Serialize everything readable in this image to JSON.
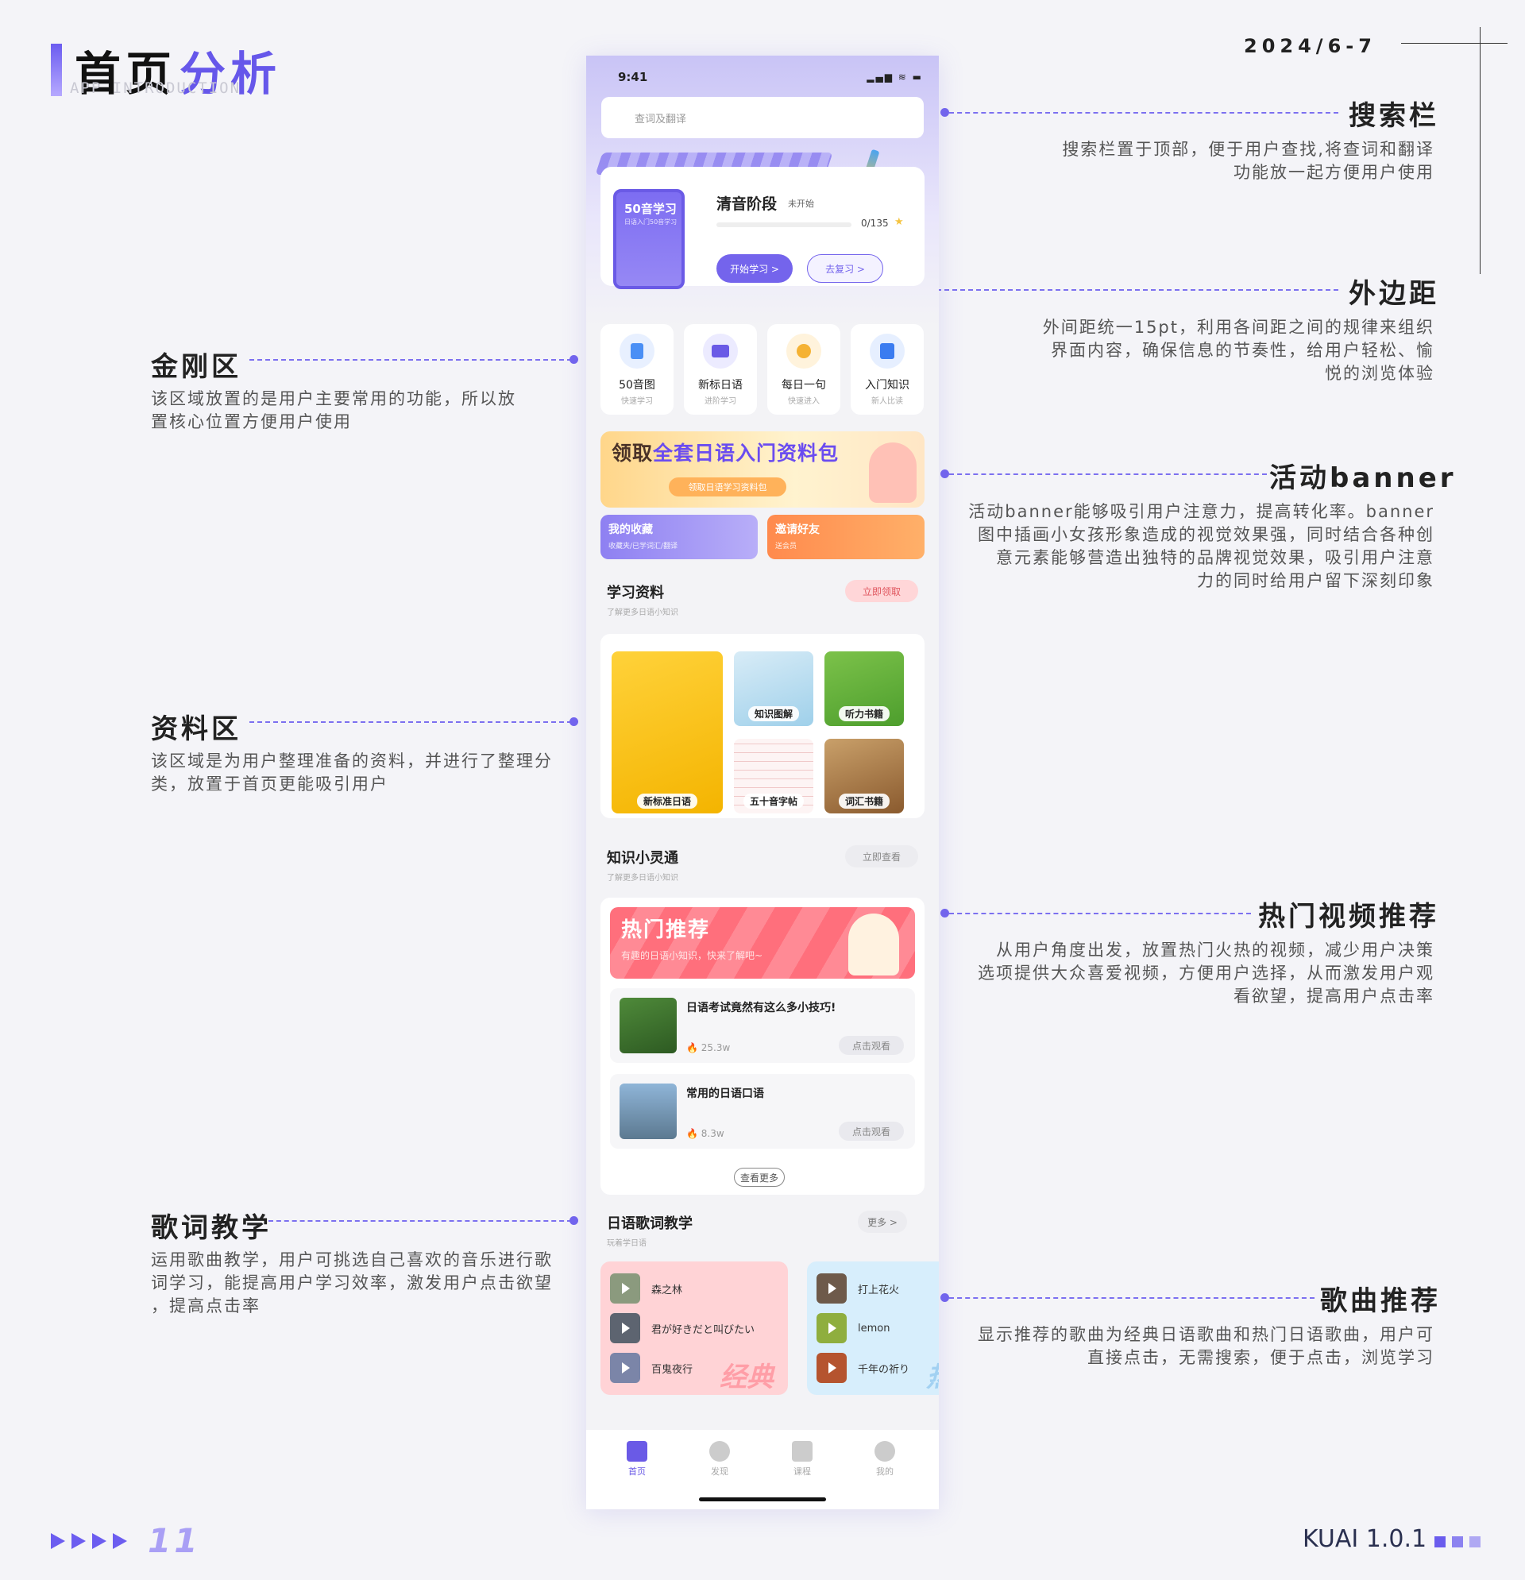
{
  "header": {
    "title_a": "首页",
    "title_b": "分析",
    "subtitle": "APP INTRODUCTION",
    "date": "2024/6-7"
  },
  "annotations": {
    "search": {
      "title": "搜索栏",
      "lines": [
        "搜索栏置于顶部，便于用户查找,将查词和翻译",
        "功能放一起方便用户使用"
      ]
    },
    "margin": {
      "title": "外边距",
      "lines": [
        "外间距统一15pt，利用各间距之间的规律来组织",
        "界面内容，确保信息的节奏性，给用户轻松、愉",
        "悦的浏览体验"
      ]
    },
    "banner": {
      "title": "活动banner",
      "lines": [
        "活动banner能够吸引用户注意力，提高转化率。banner",
        "图中插画小女孩形象造成的视觉效果强，同时结合各种创",
        "意元素能够营造出独特的品牌视觉效果，吸引用户注意",
        "力的同时给用户留下深刻印象"
      ]
    },
    "kingkong": {
      "title": "金刚区",
      "lines": [
        "该区域放置的是用户主要常用的功能，所以放",
        "置核心位置方便用户使用"
      ]
    },
    "resource": {
      "title": "资料区",
      "lines": [
        "该区域是为用户整理准备的资料，并进行了整理分",
        "类，放置于首页更能吸引用户"
      ]
    },
    "hot": {
      "title": "热门视频推荐",
      "lines": [
        "从用户角度出发，放置热门火热的视频，减少用户决策",
        "选项提供大众喜爱视频，方便用户选择，从而激发用户观",
        "看欲望，提高用户点击率"
      ]
    },
    "lyric": {
      "title": "歌词教学",
      "lines": [
        "运用歌曲教学，用户可挑选自己喜欢的音乐进行歌",
        "词学习，能提高用户学习效率，激发用户点击欲望",
        "，提高点击率"
      ]
    },
    "song": {
      "title": "歌曲推荐",
      "lines": [
        "显示推荐的歌曲为经典日语歌曲和热门日语歌曲，用户可",
        "直接点击，无需搜索，便于点击，浏览学习"
      ]
    }
  },
  "footer": {
    "page_number": "11",
    "version": "KUAI 1.0.1"
  },
  "phone": {
    "status": {
      "time": "9:41"
    },
    "search_placeholder": "查词及翻译",
    "course": {
      "book_title": "50音学习",
      "book_sub": "日语入门50音学习",
      "stage": "清音阶段",
      "stage_status": "未开始",
      "progress_text": "0/135",
      "progress": 0,
      "start": "开始学习 >",
      "review": "去复习 >"
    },
    "kingkong": [
      {
        "title": "50音图",
        "sub": "快速学习",
        "icon": "document-icon",
        "color": "#4a8ff5"
      },
      {
        "title": "新标日语",
        "sub": "进阶学习",
        "icon": "folder-icon",
        "color": "#6a5ae6"
      },
      {
        "title": "每日一句",
        "sub": "快速进入",
        "icon": "lightbulb-icon",
        "color": "#f5b233"
      },
      {
        "title": "入门知识",
        "sub": "新人比读",
        "icon": "book-icon",
        "color": "#3b7cf0"
      }
    ],
    "banner": {
      "heading_a": "领取",
      "heading_b": "全套日语入门资料包",
      "pill": "领取日语学习资料包"
    },
    "tiles": [
      {
        "title": "我的收藏",
        "sub": "收藏夹/已学词汇/翻译"
      },
      {
        "title": "邀请好友",
        "sub": "送会员"
      }
    ],
    "study": {
      "title": "学习资料",
      "sub": "了解更多日语小知识",
      "btn": "立即领取",
      "items": [
        "新标准日语",
        "知识图解",
        "听力书籍",
        "五十音字帖",
        "词汇书籍"
      ]
    },
    "knowledge": {
      "title": "知识小灵通",
      "sub": "了解更多日语小知识",
      "btn": "立即查看"
    },
    "hot": {
      "banner_title": "热门推荐",
      "banner_sub": "有趣的日语小知识，快来了解吧~",
      "videos": [
        {
          "title": "日语考试竟然有这么多小技巧!",
          "count": "25.3w",
          "btn": "点击观看"
        },
        {
          "title": "常用的日语口语",
          "count": "8.3w",
          "btn": "点击观看"
        }
      ],
      "more": "查看更多"
    },
    "lyrics": {
      "title": "日语歌词教学",
      "sub": "玩着学日语",
      "more": "更多 >",
      "classic": [
        "森之林",
        "君が好きだと叫びたい",
        "百鬼夜行"
      ],
      "classic_wm": "经典",
      "hot": [
        "打上花火",
        "lemon",
        "千年の祈り"
      ],
      "hot_wm": "热"
    },
    "tabs": [
      "首页",
      "发现",
      "课程",
      "我的"
    ]
  },
  "colors": {
    "accent": "#6657ea",
    "hot": "#ff6f7c",
    "gold": "#f5c440"
  }
}
